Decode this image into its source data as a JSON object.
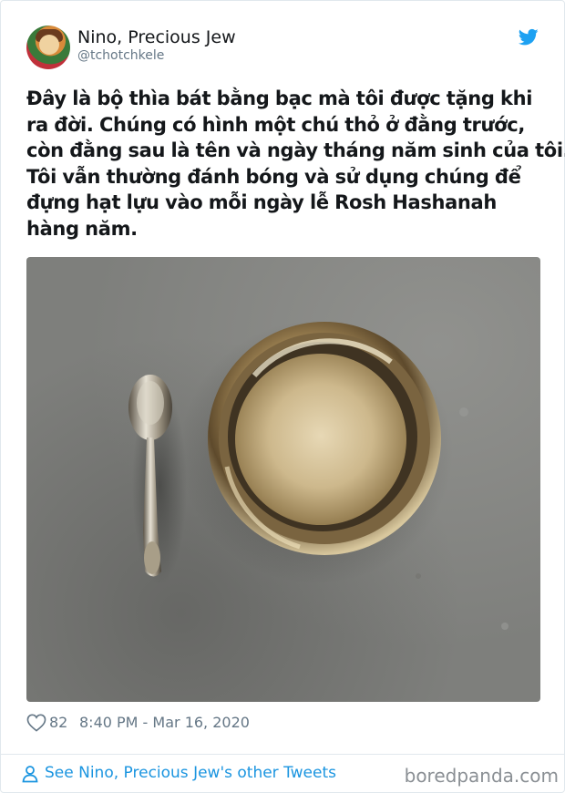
{
  "tweet": {
    "author_name": "Nino, Precious Jew",
    "author_handle": "@tchotchkele",
    "text_lines": [
      "Đây là bộ thìa bát bằng bạc mà tôi được tặng khi",
      "ra đời. Chúng có hình một chú thỏ ở đằng trước,",
      "còn đằng sau là tên và ngày tháng năm sinh của tôi.",
      "Tôi vẫn thường đánh bóng và sử dụng chúng để",
      "đựng hạt lựu vào mỗi ngày lễ Rosh Hashanah",
      "hàng năm."
    ],
    "like_count": "82",
    "timestamp": "8:40 PM - Mar 16, 2020",
    "other_tweets_link": "See Nino, Precious Jew's other Tweets"
  },
  "icons": {
    "brand": "twitter-bird-icon",
    "like": "heart-icon",
    "profile": "person-icon"
  },
  "watermark": "boredpanda.com",
  "colors": {
    "twitter_blue": "#1da1f2",
    "link_blue": "#1b95e0",
    "muted_text": "#657786",
    "border": "#e1e8ed"
  }
}
